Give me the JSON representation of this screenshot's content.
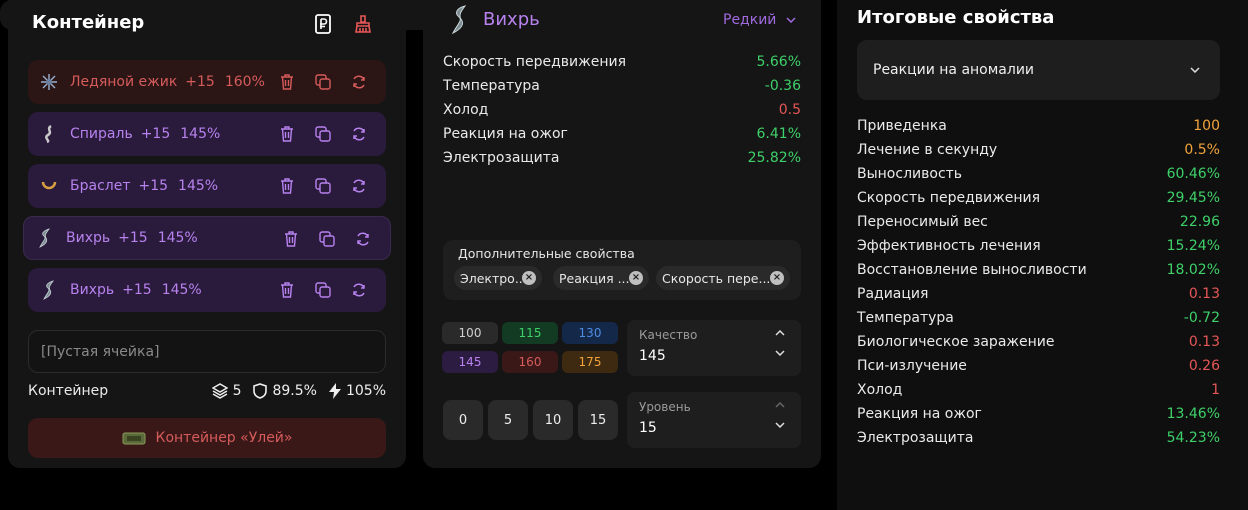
{
  "container": {
    "title": "Контейнер",
    "slots": [
      {
        "name": "Ледяной ежик",
        "level": "+15",
        "percent": "160%",
        "color": "red",
        "icon": "ice-urchin-icon",
        "selected": false
      },
      {
        "name": "Спираль",
        "level": "+15",
        "percent": "145%",
        "color": "purple",
        "icon": "spiral-icon",
        "selected": false
      },
      {
        "name": "Браслет",
        "level": "+15",
        "percent": "145%",
        "color": "purple",
        "icon": "bracelet-icon",
        "selected": false
      },
      {
        "name": "Вихрь",
        "level": "+15",
        "percent": "145%",
        "color": "purple",
        "icon": "whirl-icon",
        "selected": true
      },
      {
        "name": "Вихрь",
        "level": "+15",
        "percent": "145%",
        "color": "purple",
        "icon": "whirl-icon",
        "selected": false
      }
    ],
    "empty_slot": "[Пустая ячейка]",
    "footer_label": "Контейнер",
    "stat_layers": "5",
    "stat_shield": "89.5%",
    "stat_energy": "105%",
    "container_button": "Контейнер «Улей»"
  },
  "artifact": {
    "name": "Вихрь",
    "rarity": "Редкий",
    "stats": [
      {
        "label": "Скорость передвижения",
        "value": "5.66%",
        "color": "g"
      },
      {
        "label": "Температура",
        "value": "-0.36",
        "color": "g"
      },
      {
        "label": "Холод",
        "value": "0.5",
        "color": "r"
      },
      {
        "label": "Реакция на ожог",
        "value": "6.41%",
        "color": "g"
      },
      {
        "label": "Электрозащита",
        "value": "25.82%",
        "color": "g"
      }
    ],
    "additional_title": "Дополнительные свойства",
    "chips": [
      "Электро...",
      "Реакция ...",
      "Скорость пере..."
    ],
    "quality_buttons": [
      {
        "label": "100",
        "bg": "#2a2a2a",
        "fg": "#cfcfcf"
      },
      {
        "label": "115",
        "bg": "#133a22",
        "fg": "#3ed06a"
      },
      {
        "label": "130",
        "bg": "#14284a",
        "fg": "#4f8ce0"
      },
      {
        "label": "145",
        "bg": "#2d1c42",
        "fg": "#b782ee"
      },
      {
        "label": "160",
        "bg": "#3a1818",
        "fg": "#d65b5b"
      },
      {
        "label": "175",
        "bg": "#3e2a10",
        "fg": "#f2a33a"
      }
    ],
    "quality_label": "Качество",
    "quality_value": "145",
    "level_buttons": [
      "0",
      "5",
      "10",
      "15"
    ],
    "level_label": "Уровень",
    "level_value": "15"
  },
  "totals": {
    "title": "Итоговые свойства",
    "dropdown": "Реакции на аномалии",
    "stats": [
      {
        "label": "Приведенка",
        "value": "100",
        "color": "o"
      },
      {
        "label": "Лечение в секунду",
        "value": "0.5%",
        "color": "o"
      },
      {
        "label": "Выносливость",
        "value": "60.46%",
        "color": "g"
      },
      {
        "label": "Скорость передвижения",
        "value": "29.45%",
        "color": "g"
      },
      {
        "label": "Переносимый вес",
        "value": "22.96",
        "color": "g"
      },
      {
        "label": "Эффективность лечения",
        "value": "15.24%",
        "color": "g"
      },
      {
        "label": "Восстановление выносливости",
        "value": "18.02%",
        "color": "g"
      },
      {
        "label": "Радиация",
        "value": "0.13",
        "color": "r"
      },
      {
        "label": "Температура",
        "value": "-0.72",
        "color": "g"
      },
      {
        "label": "Биологическое заражение",
        "value": "0.13",
        "color": "r"
      },
      {
        "label": "Пси-излучение",
        "value": "0.26",
        "color": "r"
      },
      {
        "label": "Холод",
        "value": "1",
        "color": "r"
      },
      {
        "label": "Реакция на ожог",
        "value": "13.46%",
        "color": "g"
      },
      {
        "label": "Электрозащита",
        "value": "54.23%",
        "color": "g"
      }
    ]
  }
}
